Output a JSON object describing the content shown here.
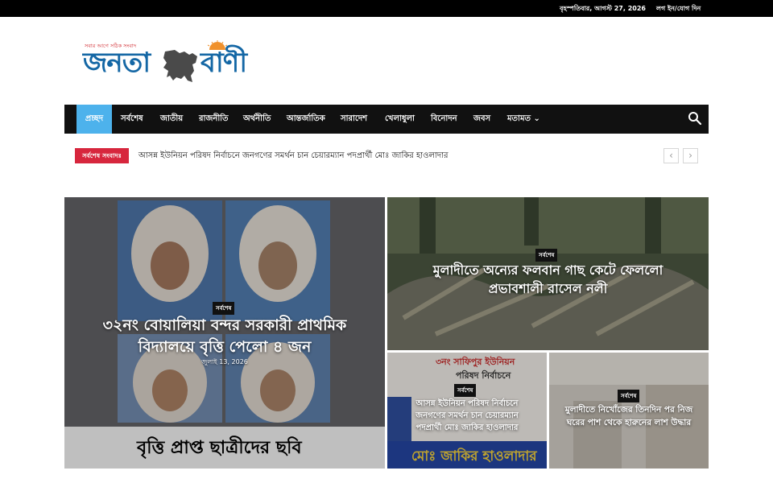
{
  "topbar": {
    "date": "বৃহস্পতিবার, আগস্ট 27, 2026",
    "login": "লগ ইন/যোগ দিন"
  },
  "logo": {
    "tagline": "সবার আগে সঠিক সংবাদ",
    "word1": "জনতা",
    "word2": "বাণী",
    "accent": "#d0282e",
    "brand": "#1467a5"
  },
  "nav": {
    "items": [
      {
        "label": "প্রচ্ছদ"
      },
      {
        "label": "সর্বশেষ"
      },
      {
        "label": "জাতীয়"
      },
      {
        "label": "রাজনীতি"
      },
      {
        "label": "অর্থনীতি"
      },
      {
        "label": "আন্তর্জাতিক"
      },
      {
        "label": "সারাদেশ"
      },
      {
        "label": "খেলাধুলা"
      },
      {
        "label": "বিনোদন"
      },
      {
        "label": "জবস"
      },
      {
        "label": "মতামত ⌄"
      }
    ],
    "active_color": "#4db2ec",
    "search_icon": "search-icon"
  },
  "ticker": {
    "label": "সর্বশেষ সংবাদঃ",
    "text": "আসন্ন ইউনিয়ন পরিষদ নির্বাচনে জনগণের সমর্থন চান চেয়ারম্যান পদপ্রার্থী মোঃ জাকির হাওলাদার",
    "prev": "‹",
    "next": "›"
  },
  "posts": {
    "main": {
      "category": "সর্বশেষ",
      "title_line1": "৩২নং বোয়ালিয়া বন্দর সরকারী প্রাথমিক",
      "title_line2": "বিদ্যালয়ে বৃত্তি পেলো ৪ জন",
      "date": "জুলাই 13, 2026",
      "caption": "বৃত্তি প্রাপ্ত ছাত্রীদের ছবি"
    },
    "right_top": {
      "category": "সর্বশেষ",
      "title_line1": "মুলাদীতে অন্যের ফলবান গাছ কেটে ফেললো",
      "title_line2": "প্রভাবশালী রাসেল নলী"
    },
    "bottom_left": {
      "category": "সর্বশেষ",
      "title_line1": "আসন্ন ইউনিয়ন পরিষদ নির্বাচনে",
      "title_line2": "জনগণের সমর্থন চান চেয়ারম্যান",
      "title_line3": "পদপ্রার্থী মোঃ জাকির হাওলাদার",
      "banner_top": "৩নং সাফিপুর ইউনিয়ন",
      "banner_mid": "পরিষদ নির্বাচনে",
      "banner_bottom": "মোঃ জাকির হাওলাদার"
    },
    "bottom_right": {
      "category": "সর্বশেষ",
      "title_line1": "মুলাদীতে নিখোঁজের তিনদিন পর নিজ",
      "title_line2": "ঘরের পাশ থেকে হারুনের লাশ উদ্ধার"
    }
  }
}
